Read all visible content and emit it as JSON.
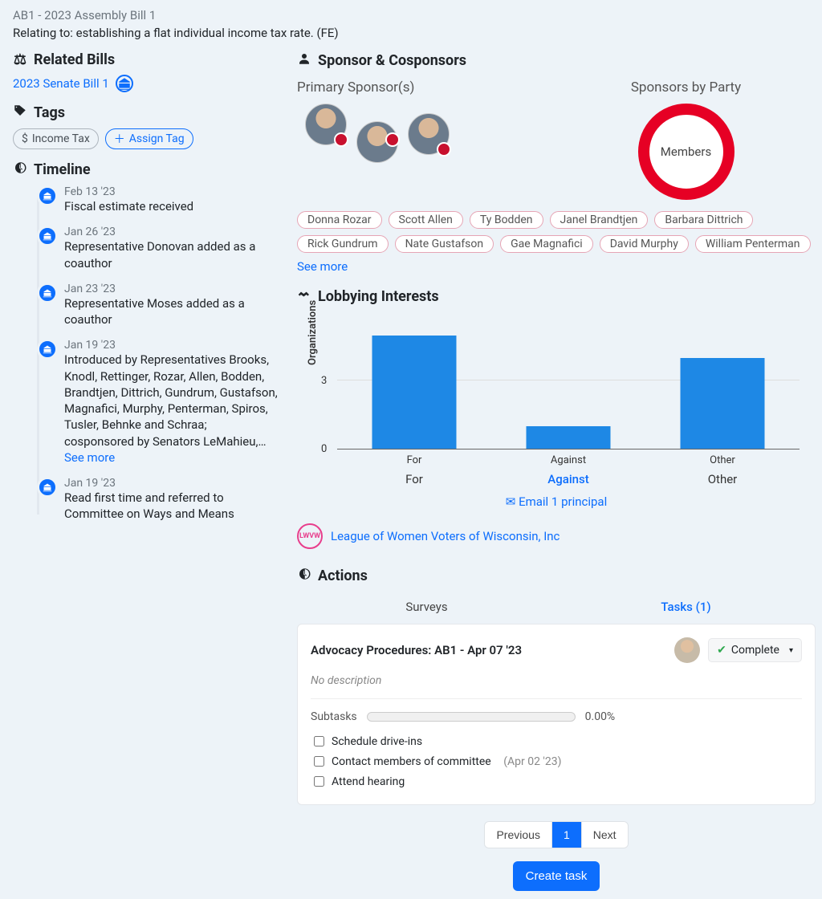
{
  "bill": {
    "title": "AB1 - 2023 Assembly Bill 1",
    "description": "Relating to: establishing a flat individual income tax rate. (FE)"
  },
  "related_bills": {
    "heading": "Related Bills",
    "items": [
      "2023 Senate Bill 1"
    ]
  },
  "tags": {
    "heading": "Tags",
    "items": [
      "Income Tax"
    ],
    "assign_label": "Assign Tag"
  },
  "timeline": {
    "heading": "Timeline",
    "see_more_label": "See more",
    "items": [
      {
        "date": "Feb 13 '23",
        "text": "Fiscal estimate received"
      },
      {
        "date": "Jan 26 '23",
        "text": "Representative Donovan added as a coauthor"
      },
      {
        "date": "Jan 23 '23",
        "text": "Representative Moses added as a coauthor"
      },
      {
        "date": "Jan 19 '23",
        "text": "Introduced by Representatives Brooks, Knodl, Rettinger, Rozar, Allen, Bodden, Brandtjen, Dittrich, Gundrum, Gustafson, Magnafici, Murphy, Penterman, Spiros, Tusler, Behnke and Schraa; cosponsored by Senators LeMahieu,…",
        "has_more": true
      },
      {
        "date": "Jan 19 '23",
        "text": "Read first time and referred to Committee on Ways and Means"
      }
    ]
  },
  "sponsors": {
    "heading": "Sponsor & Cosponsors",
    "primary_heading": "Primary Sponsor(s)",
    "party_heading": "Sponsors by Party",
    "party_center_label": "Members",
    "see_more_label": "See more",
    "cosponsors": [
      "Donna Rozar",
      "Scott Allen",
      "Ty Bodden",
      "Janel Brandtjen",
      "Barbara Dittrich",
      "Rick Gundrum",
      "Nate Gustafson",
      "Gae Magnafici",
      "David Murphy",
      "William Penterman"
    ]
  },
  "lobbying": {
    "heading": "Lobbying Interests",
    "y_axis_label": "Organizations",
    "categories": [
      "For",
      "Against",
      "Other"
    ],
    "selected_category": "Against",
    "email_label": "Email 1 principal",
    "org": {
      "badge": "LWVW",
      "name": "League of Women Voters of Wisconsin, Inc"
    }
  },
  "chart_data": {
    "type": "bar",
    "categories": [
      "For",
      "Against",
      "Other"
    ],
    "values": [
      5,
      1,
      4
    ],
    "ylabel": "Organizations",
    "ylim": [
      0,
      6
    ]
  },
  "actions": {
    "heading": "Actions",
    "tabs": {
      "surveys": "Surveys",
      "tasks": "Tasks (1)"
    },
    "task": {
      "title": "Advocacy Procedures: AB1 - Apr 07 '23",
      "no_description": "No description",
      "status_label": "Complete",
      "subtasks_label": "Subtasks",
      "progress_text": "0.00%",
      "items": [
        {
          "label": "Schedule drive-ins",
          "date": ""
        },
        {
          "label": "Contact members of committee",
          "date": "(Apr 02 '23)"
        },
        {
          "label": "Attend hearing",
          "date": ""
        }
      ]
    },
    "pagination": {
      "previous": "Previous",
      "page": "1",
      "next": "Next"
    },
    "create_label": "Create task"
  }
}
